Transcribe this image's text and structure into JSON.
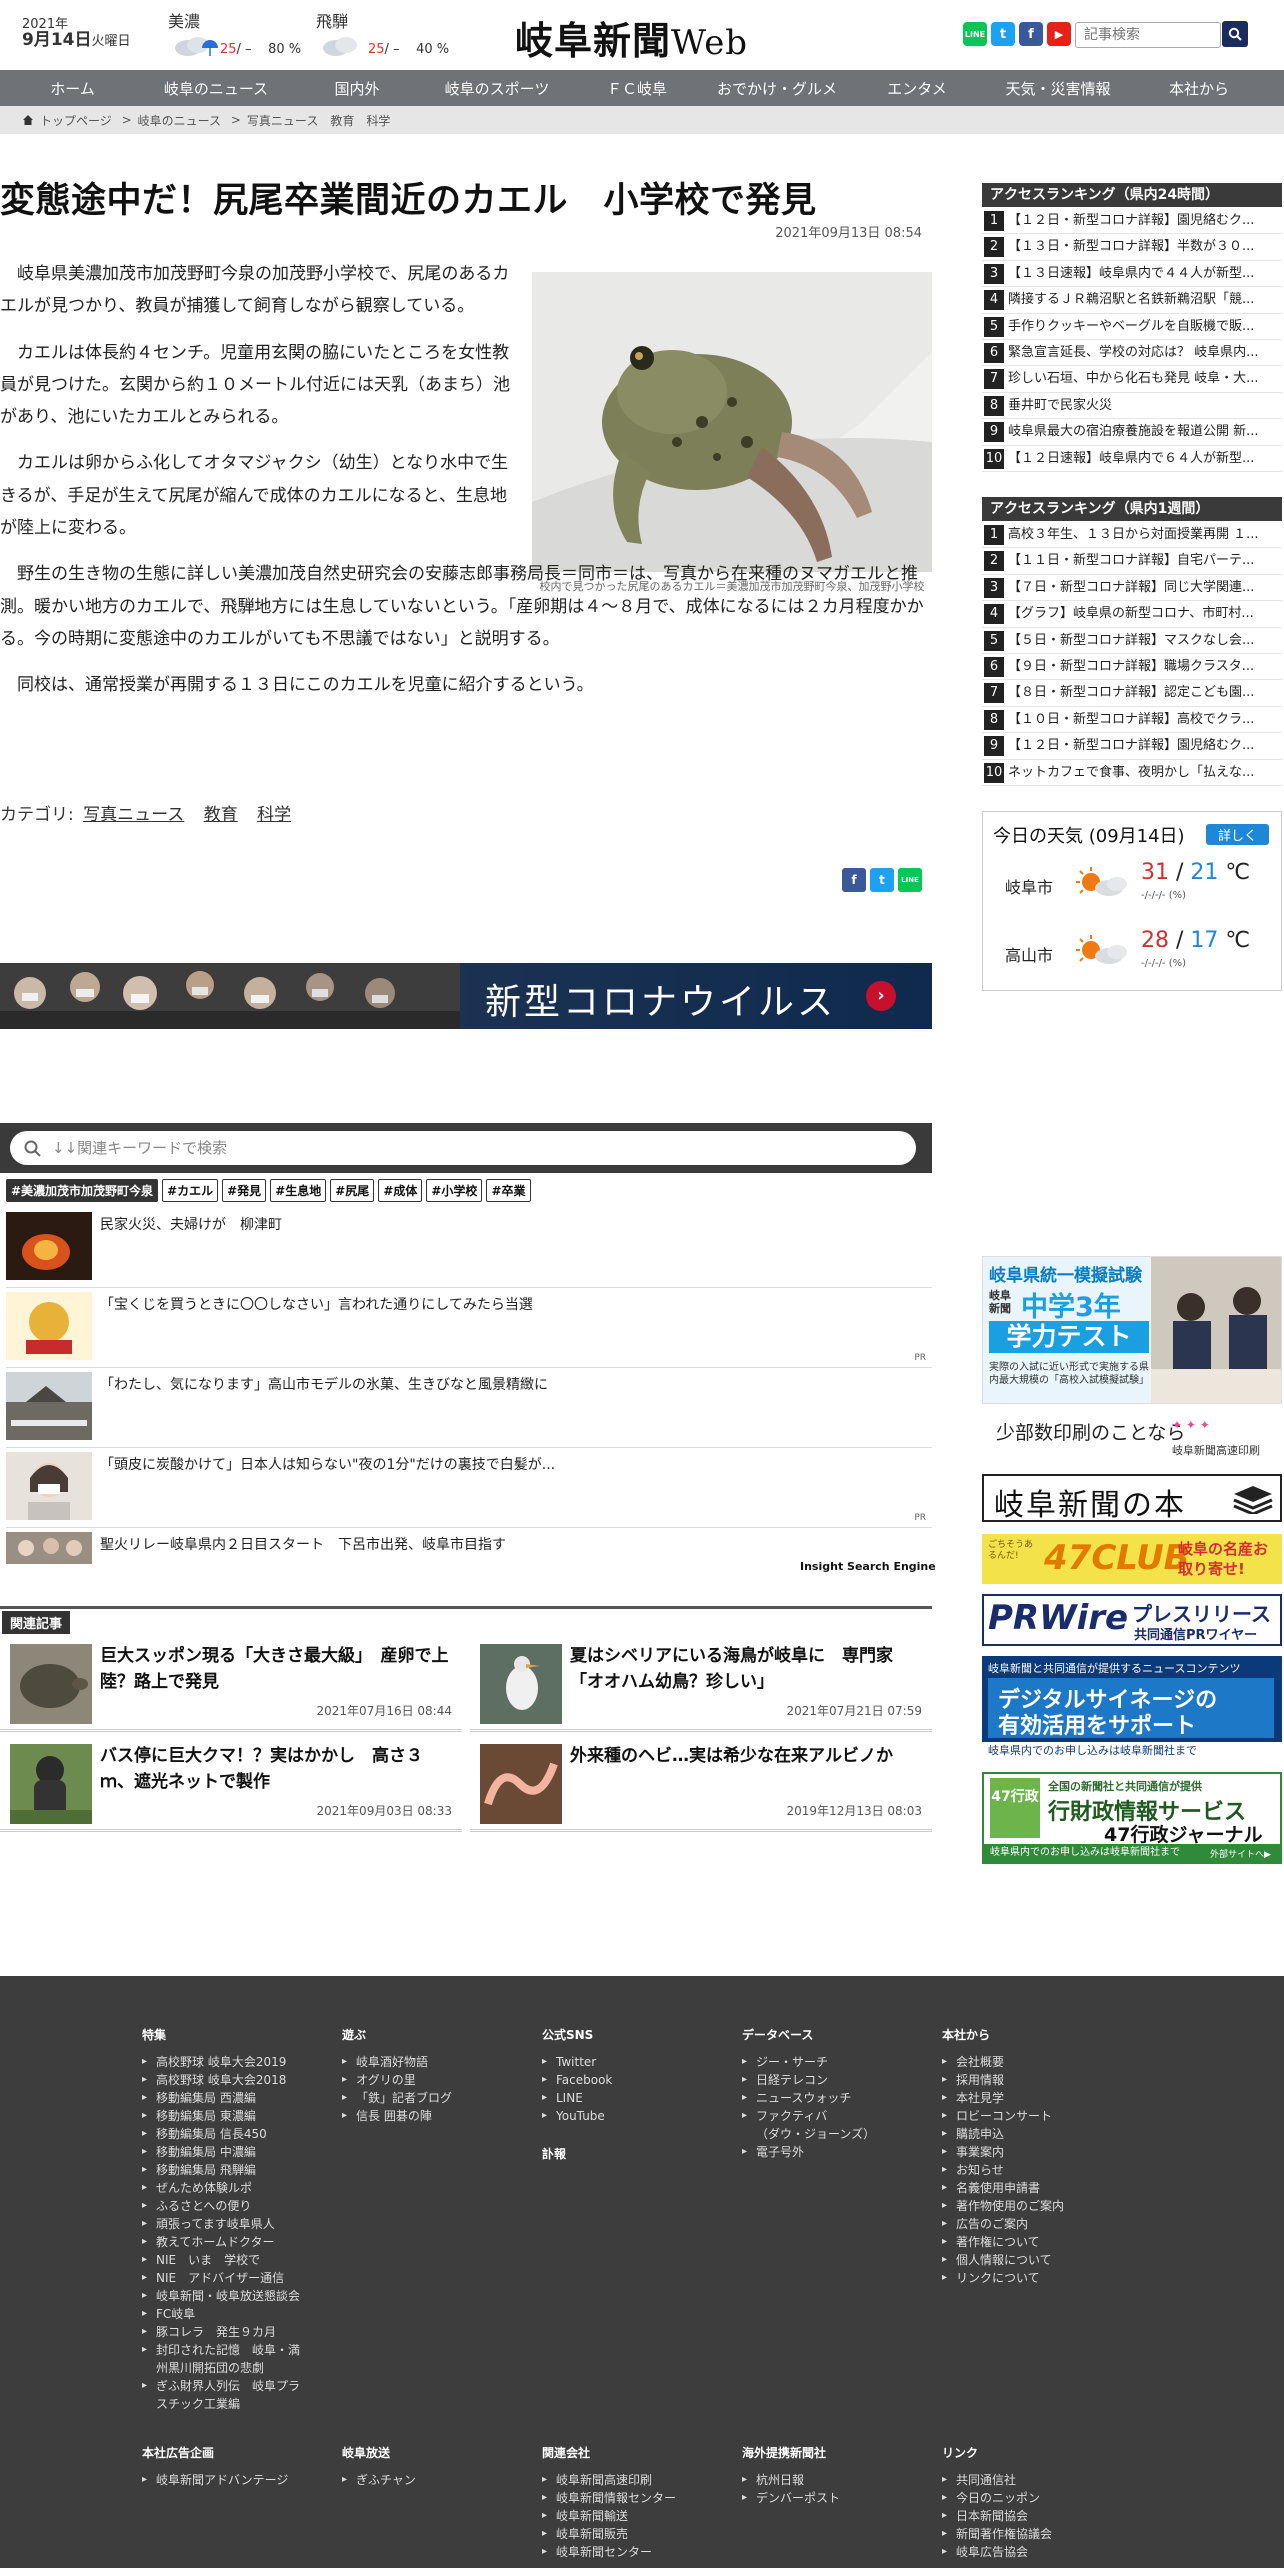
{
  "header": {
    "date_year": "2021年",
    "date_month_day": "9月14日",
    "date_dow": "火曜日",
    "weather_mini": [
      {
        "name": "美濃",
        "hi": "25",
        "lo": "/ –",
        "pop": "80 %"
      },
      {
        "name": "飛騨",
        "hi": "25",
        "lo": "/ –",
        "pop": "40 %"
      }
    ],
    "logo": "岐阜新聞",
    "logo_web": "Web",
    "search_placeholder": "記事検索",
    "sns": [
      "LINE",
      "t",
      "f",
      "▶"
    ]
  },
  "nav": [
    "ホーム",
    "岐阜のニュース",
    "国内外",
    "岐阜のスポーツ",
    "ＦＣ岐阜",
    "おでかけ・グルメ",
    "エンタメ",
    "天気・災害情報",
    "本社から"
  ],
  "breadcrumb": [
    "トップページ",
    "岐阜のニュース",
    "写真ニュース",
    "教育",
    "科学"
  ],
  "article": {
    "title": "変態途中だ！尻尾卒業間近のカエル　小学校で発見",
    "date": "2021年09月13日 08:54",
    "paragraphs": [
      "岐阜県美濃加茂市加茂野町今泉の加茂野小学校で、尻尾のあるカエルが見つかり、教員が捕獲して飼育しながら観察している。",
      "カエルは体長約４センチ。児童用玄関の脇にいたところを女性教員が見つけた。玄関から約１０メートル付近には天乳（あまち）池があり、池にいたカエルとみられる。",
      "カエルは卵からふ化してオタマジャクシ（幼生）となり水中で生きるが、手足が生えて尻尾が縮んで成体のカエルになると、生息地が陸上に変わる。",
      "野生の生き物の生態に詳しい美濃加茂自然史研究会の安藤志郎事務局長＝同市＝は、写真から在来種のヌマガエルと推測。暖かい地方のカエルで、飛騨地方には生息していないという。「産卵期は４～８月で、成体になるには２カ月程度かかる。今の時期に変態途中のカエルがいても不思議ではない」と説明する。",
      "同校は、通常授業が再開する１３日にこのカエルを児童に紹介するという。"
    ],
    "photo_caption": "校内で見つかった尻尾のあるカエル＝美濃加茂市加茂野町今泉、加茂野小学校",
    "category_label": "カテゴリ:",
    "categories": [
      "写真ニュース",
      "教育",
      "科学"
    ]
  },
  "corona_banner": "新型コロナウイルス",
  "keyword_search_placeholder": "↓↓関連キーワードで検索",
  "tags": [
    "#美濃加茂市加茂野町今泉",
    "#カエル",
    "#発見",
    "#生息地",
    "#尻尾",
    "#成体",
    "#小学校",
    "#卒業"
  ],
  "recommendations": [
    {
      "title": "民家火災、夫婦けが　柳津町",
      "pr": ""
    },
    {
      "title": "「宝くじを買うときに〇〇しなさい」言われた通りにしてみたら当選",
      "pr": "PR"
    },
    {
      "title": "「わたし、気になります」高山市モデルの氷菓、生きびなと風景精緻に",
      "pr": ""
    },
    {
      "title": "「頭皮に炭酸かけて」日本人は知らない\"夜の1分\"だけの裏技で白髪が...",
      "pr": "PR"
    },
    {
      "title": "聖火リレー岐阜県内２日目スタート　下呂市出発、岐阜市目指す",
      "pr": ""
    }
  ],
  "insight_label": "Insight Search Engine",
  "related_label": "関連記事",
  "related": [
    {
      "title": "巨大スッポン現る「大きさ最大級」　産卵で上陸？路上で発見",
      "date": "2021年07月16日 08:44"
    },
    {
      "title": "夏はシベリアにいる海鳥が岐阜に　専門家「オオハム幼鳥？珍しい」",
      "date": "2021年07月21日 07:59"
    },
    {
      "title": "バス停に巨大クマ！？実はかかし　高さ３ｍ、遮光ネットで製作",
      "date": "2021年09月03日 08:33"
    },
    {
      "title": "外来種のヘビ…実は希少な在来アルビノか",
      "date": "2019年12月13日 08:03"
    }
  ],
  "ranking_24h": {
    "title": "アクセスランキング（県内24時間）",
    "items": [
      "【１２日・新型コロナ詳報】園児絡むク...",
      "【１３日・新型コロナ詳報】半数が３０...",
      "【１３日速報】岐阜県内で４４人が新型...",
      "隣接するＪＲ鵜沼駅と名鉄新鵜沼駅「競...",
      "手作りクッキーやベーグルを自販機で販...",
      "緊急宣言延長、学校の対応は？ 岐阜県内...",
      "珍しい石垣、中から化石も発見 岐阜・大...",
      "垂井町で民家火災",
      "岐阜県最大の宿泊療養施設を報道公開 新...",
      "【１２日速報】岐阜県内で６４人が新型..."
    ]
  },
  "ranking_week": {
    "title": "アクセスランキング（県内1週間）",
    "items": [
      "高校３年生、１３日から対面授業再開 １...",
      "【１１日・新型コロナ詳報】自宅パーテ...",
      "【７日・新型コロナ詳報】同じ大学関連...",
      "【グラフ】岐阜県の新型コロナ、市町村...",
      "【５日・新型コロナ詳報】マスクなし会...",
      "【９日・新型コロナ詳報】職場クラスタ...",
      "【８日・新型コロナ詳報】認定こども園...",
      "【１０日・新型コロナ詳報】高校でクラ...",
      "【１２日・新型コロナ詳報】園児絡むク...",
      "ネットカフェで食事、夜明かし「払えな..."
    ]
  },
  "today_weather": {
    "title": "今日の天気 (09月14日)",
    "more": "詳しく",
    "cities": [
      {
        "name": "岐阜市",
        "hi": "31",
        "lo": "21",
        "unit": "℃",
        "pop": "-/-/-/- (%)"
      },
      {
        "name": "高山市",
        "hi": "28",
        "lo": "17",
        "unit": "℃",
        "pop": "-/-/-/- (%)"
      }
    ]
  },
  "ads": {
    "exam_title": "岐阜県統一模擬試験",
    "exam_sub": "中学3年",
    "exam_sub2": "学力テスト",
    "exam_brand": "岐阜新聞",
    "exam_note": "実際の入試に近い形式で実施する県内最大規模の「高校入試模擬試験」",
    "print_title": "少部数印刷のことなら",
    "print_company": "岐阜新聞高速印刷",
    "book": "岐阜新聞の本",
    "club_brand": "47CLUB",
    "club_text": "岐阜の名産お取り寄せ!",
    "club_note": "ごちそうあるんだ!",
    "prwire_brand": "PRWire",
    "prwire_name": "プレスリリース",
    "prwire_sub": "共同通信PRワイヤー",
    "signage_top": "岐阜新聞と共同通信が提供するニュースコンテンツ",
    "signage_main": "デジタルサイネージの",
    "signage_main2": "有効活用をサポート",
    "signage_bottom": "岐阜県内でのお申し込みは岐阜新聞社まで",
    "gyosei_brand": "47行政",
    "gyosei_top": "全国の新聞社と共同通信が提供",
    "gyosei_main": "行財政情報サービス",
    "gyosei_sub": "47行政ジャーナル",
    "gyosei_bottom": "岐阜県内でのお申し込みは岐阜新聞社まで",
    "gyosei_link": "外部サイトへ▶"
  },
  "footer": {
    "columns": [
      {
        "head": "特集",
        "items": [
          "高校野球 岐阜大会2019",
          "高校野球 岐阜大会2018",
          "移動編集局 西濃編",
          "移動編集局 東濃編",
          "移動編集局 信長450",
          "移動編集局 中濃編",
          "移動編集局 飛騨編",
          "ぜんため体験ルポ",
          "ふるさとへの便り",
          "頑張ってます岐阜県人",
          "教えてホームドクター",
          "NIE　いま　学校で",
          "NIE　アドバイザー通信",
          "岐阜新聞・岐阜放送懇談会",
          "FC岐阜",
          "豚コレラ　発生９カ月",
          "封印された記憶　岐阜・満州黒川開拓団の悲劇",
          "ぎふ財界人列伝　岐阜プラスチック工業編"
        ]
      },
      {
        "head": "遊ぶ",
        "items": [
          "岐阜酒好物語",
          "オグリの里",
          "「鉄」記者ブログ",
          "信長 囲碁の陣"
        ]
      },
      {
        "head": "公式SNS",
        "items": [
          "Twitter",
          "Facebook",
          "LINE",
          "YouTube"
        ],
        "head2": "訃報"
      },
      {
        "head": "データベース",
        "items": [
          "ジー・サーチ",
          "日経テレコン",
          "ニュースウォッチ",
          "ファクティバ",
          "（ダウ・ジョーンズ）",
          "電子号外"
        ]
      },
      {
        "head": "本社から",
        "items": [
          "会社概要",
          "採用情報",
          "本社見学",
          "ロビーコンサート",
          "購読申込",
          "事業案内",
          "お知らせ",
          "名義使用申請書",
          "著作物使用のご案内",
          "広告のご案内",
          "著作権について",
          "個人情報について",
          "リンクについて"
        ]
      }
    ],
    "columns2": [
      {
        "head": "本社広告企画",
        "items": [
          "岐阜新聞アドバンテージ"
        ]
      },
      {
        "head": "岐阜放送",
        "items": [
          "ぎふチャン"
        ]
      },
      {
        "head": "関連会社",
        "items": [
          "岐阜新聞高速印刷",
          "岐阜新聞情報センター",
          "岐阜新聞輸送",
          "岐阜新聞販売",
          "岐阜新聞センター"
        ]
      },
      {
        "head": "海外提携新聞社",
        "items": [
          "杭州日報",
          "デンバーポスト"
        ]
      },
      {
        "head": "リンク",
        "items": [
          "共同通信社",
          "今日のニッポン",
          "日本新聞協会",
          "新聞著作権協議会",
          "岐阜広告協会"
        ]
      }
    ]
  }
}
